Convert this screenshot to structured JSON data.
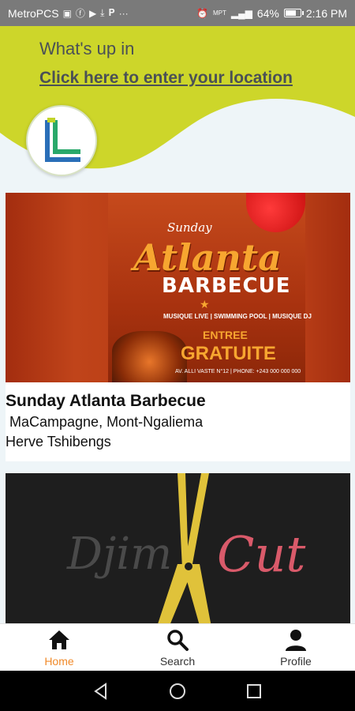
{
  "status_bar": {
    "carrier": "MetroPCS",
    "network": "MPT",
    "battery": "64%",
    "battery_level": 0.64,
    "time": "2:16 PM"
  },
  "header": {
    "greeting": "What's up in",
    "location_link": "Click here to enter your location",
    "wave_color": "#cdd62a"
  },
  "events": [
    {
      "title": "Sunday Atlanta Barbecue",
      "venue": " MaCampagne, Mont-Ngaliema",
      "organizer": "Herve Tshibengs",
      "poster": {
        "sunday": "Sunday",
        "atlanta": "Atlanta",
        "barbecue": "BARBECUE",
        "subtitle": "MUSIQUE LIVE | SWIMMING POOL | MUSIQUE DJ",
        "entree": "ENTREE",
        "gratuite": "GRATUITE",
        "footer": "AV. ALLI VASTE N°12 | PHONE: +243 000 000 000"
      }
    },
    {
      "poster": {
        "left_word": "Djim",
        "right_word": "Cut"
      }
    }
  ],
  "bottom_nav": {
    "items": [
      {
        "label": "Home",
        "icon": "home-icon",
        "active": true
      },
      {
        "label": "Search",
        "icon": "search-icon",
        "active": false
      },
      {
        "label": "Profile",
        "icon": "profile-icon",
        "active": false
      }
    ],
    "active_color": "#f08a2a"
  }
}
